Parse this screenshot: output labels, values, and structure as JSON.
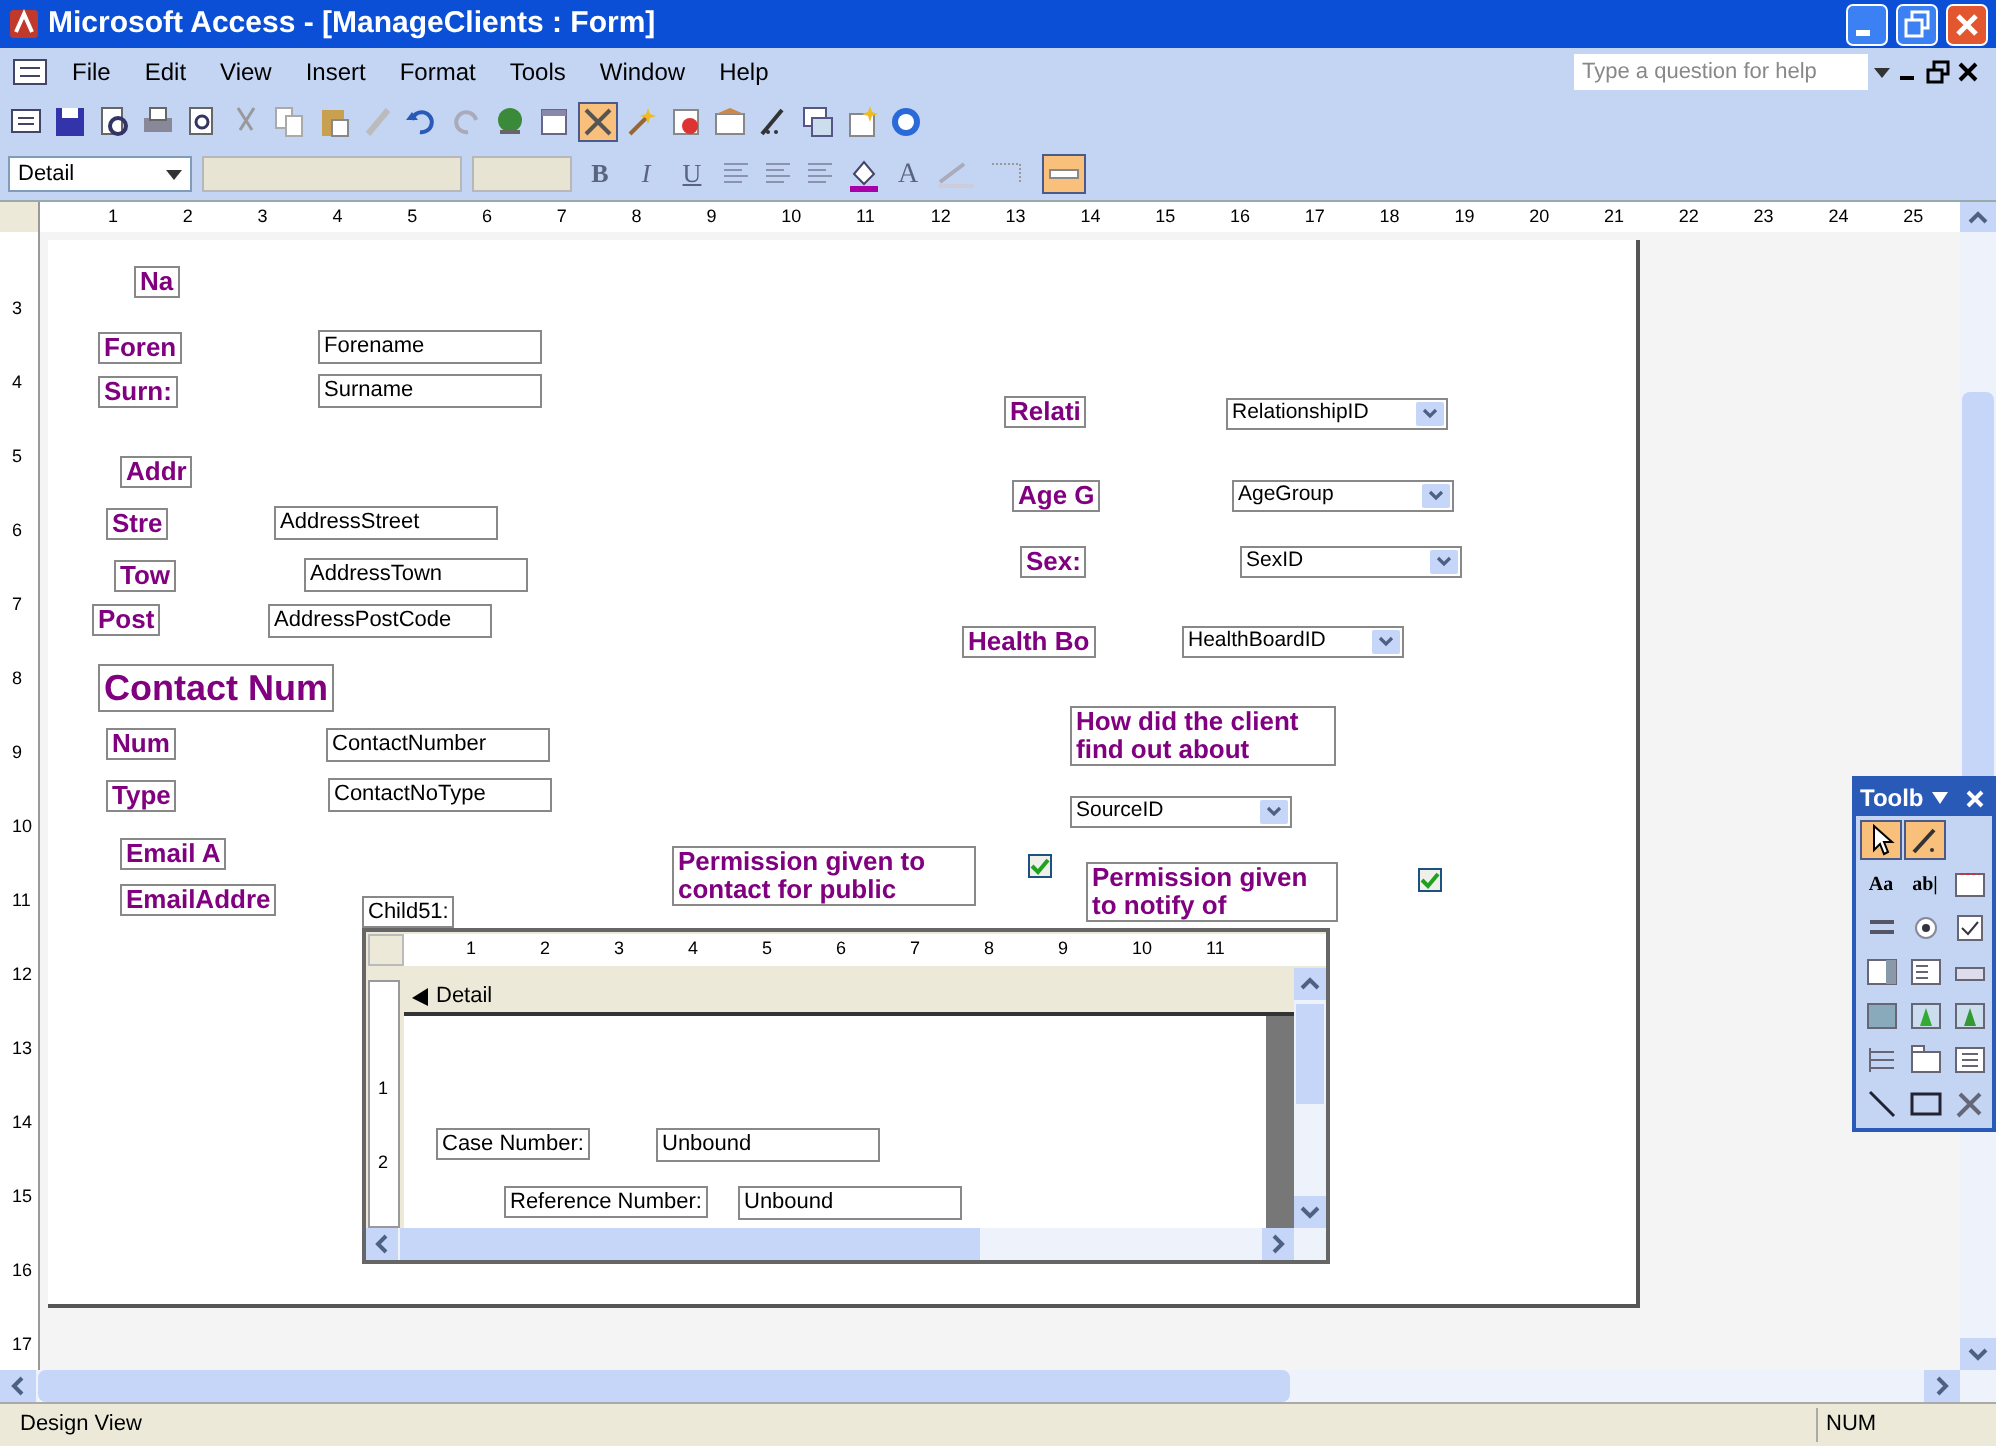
{
  "window": {
    "title": "Microsoft Access - [ManageClients : Form]"
  },
  "menu": {
    "items": [
      "File",
      "Edit",
      "View",
      "Insert",
      "Format",
      "Tools",
      "Window",
      "Help"
    ],
    "help_box": {
      "placeholder": "Type a question for help"
    }
  },
  "formatting": {
    "object_combo": "Detail",
    "bold": "B",
    "italic": "I",
    "underline": "U",
    "font_color": "A"
  },
  "ruler": {
    "labels": [
      "1",
      "2",
      "3",
      "4",
      "5",
      "6",
      "7",
      "8",
      "9",
      "10",
      "11",
      "12",
      "13",
      "14",
      "15",
      "16",
      "17",
      "18",
      "19",
      "20",
      "21",
      "22",
      "23",
      "24",
      "25"
    ]
  },
  "vertical_ruler": {
    "labels": [
      "3",
      "4",
      "5",
      "6",
      "7",
      "8",
      "9",
      "10",
      "11",
      "12",
      "13",
      "14",
      "15",
      "16",
      "17"
    ]
  },
  "controls": [
    {
      "kind": "label",
      "text": "Na"
    },
    {
      "kind": "label",
      "text": "Foren"
    },
    {
      "kind": "textbox",
      "text": "Forename"
    },
    {
      "kind": "label",
      "text": "Surn:"
    },
    {
      "kind": "textbox",
      "text": "Surname"
    },
    {
      "kind": "label",
      "text": "Addr"
    },
    {
      "kind": "label",
      "text": "Stre"
    },
    {
      "kind": "textbox",
      "text": "AddressStreet"
    },
    {
      "kind": "label",
      "text": "Tow"
    },
    {
      "kind": "textbox",
      "text": "AddressTown"
    },
    {
      "kind": "label",
      "text": "Post"
    },
    {
      "kind": "textbox",
      "text": "AddressPostCode"
    },
    {
      "kind": "heading",
      "text": "Contact Num"
    },
    {
      "kind": "label",
      "text": "Num"
    },
    {
      "kind": "textbox",
      "text": "ContactNumber"
    },
    {
      "kind": "label",
      "text": "Type"
    },
    {
      "kind": "textbox",
      "text": "ContactNoType"
    },
    {
      "kind": "label",
      "text": "Email A"
    },
    {
      "kind": "label",
      "text": "EmailAddre"
    },
    {
      "kind": "label",
      "text": "Permission given to contact for public"
    },
    {
      "kind": "checkbox",
      "checked": true
    },
    {
      "kind": "label",
      "text": "Relati"
    },
    {
      "kind": "combo",
      "text": "RelationshipID"
    },
    {
      "kind": "label",
      "text": "Age G"
    },
    {
      "kind": "combo",
      "text": "AgeGroup"
    },
    {
      "kind": "label",
      "text": "Sex:"
    },
    {
      "kind": "combo",
      "text": "SexID"
    },
    {
      "kind": "label",
      "text": "Health Bo"
    },
    {
      "kind": "combo",
      "text": "HealthBoardID"
    },
    {
      "kind": "label",
      "text": "How did the client find out about"
    },
    {
      "kind": "combo",
      "text": "SourceID"
    },
    {
      "kind": "label",
      "text": "Permission given to notify of"
    },
    {
      "kind": "checkbox",
      "checked": true
    }
  ],
  "subform": {
    "label": "Child51:",
    "ruler_labels": [
      "1",
      "2",
      "3",
      "4",
      "5",
      "6",
      "7",
      "8",
      "9",
      "10",
      "11"
    ],
    "vertical_labels": [
      "1",
      "2"
    ],
    "section": "Detail",
    "controls": [
      {
        "kind": "label",
        "text": "Case Number:"
      },
      {
        "kind": "textbox",
        "text": "Unbound"
      },
      {
        "kind": "label",
        "text": "Reference Number:"
      },
      {
        "kind": "textbox",
        "text": "Unbound"
      }
    ]
  },
  "toolbox": {
    "title": "Toolb",
    "tools": [
      {
        "selected": true
      },
      {
        "selected": true
      },
      {
        "selected": false,
        "glyph": "Aa"
      },
      {
        "selected": false,
        "glyph": "ab|"
      },
      {
        "selected": false
      },
      {
        "selected": false
      },
      {
        "selected": false
      },
      {
        "selected": false
      },
      {
        "selected": false
      },
      {
        "selected": false
      },
      {
        "selected": false
      },
      {
        "selected": false
      },
      {
        "selected": false
      },
      {
        "selected": false
      },
      {
        "selected": false
      },
      {
        "selected": false
      },
      {
        "selected": false
      },
      {
        "selected": false
      },
      {
        "selected": false
      },
      {
        "selected": false
      }
    ]
  },
  "status_bar": {
    "mode": "Design View",
    "indicator": "NUM"
  }
}
